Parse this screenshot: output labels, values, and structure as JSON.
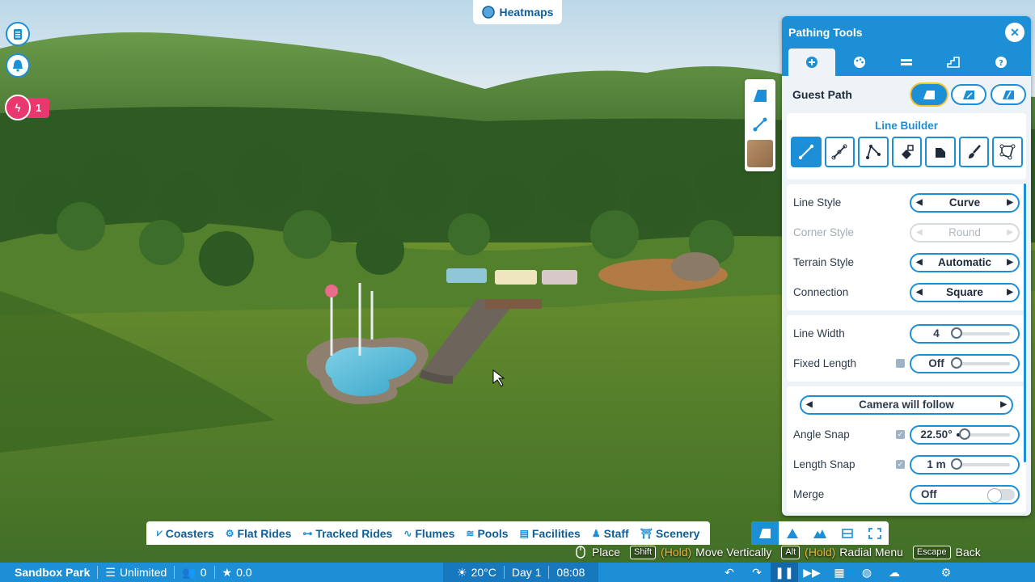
{
  "topbar": {
    "heatmaps_label": "Heatmaps"
  },
  "left_hud": {
    "notification_count": "1"
  },
  "panel": {
    "title": "Pathing Tools",
    "guest_path_label": "Guest Path",
    "line_builder_title": "Line Builder",
    "options": [
      {
        "label": "Line Style",
        "value": "Curve"
      },
      {
        "label": "Corner Style",
        "value": "Round"
      },
      {
        "label": "Terrain Style",
        "value": "Automatic"
      },
      {
        "label": "Connection",
        "value": "Square"
      }
    ],
    "line_width": {
      "label": "Line Width",
      "value": "4",
      "level": 0.0
    },
    "fixed_length": {
      "label": "Fixed Length",
      "value": "Off",
      "level": 0.0
    },
    "camera": {
      "value": "Camera will follow"
    },
    "angle_snap": {
      "label": "Angle Snap",
      "value": "22.50°",
      "level": 0.15
    },
    "length_snap": {
      "label": "Length Snap",
      "value": "1 m",
      "level": 0.0
    },
    "merge": {
      "label": "Merge",
      "value": "Off"
    }
  },
  "categories": [
    {
      "label": "Coasters",
      "icon": "coaster-icon"
    },
    {
      "label": "Flat Rides",
      "icon": "flat-ride-icon"
    },
    {
      "label": "Tracked Rides",
      "icon": "tracked-ride-icon"
    },
    {
      "label": "Flumes",
      "icon": "flume-icon"
    },
    {
      "label": "Pools",
      "icon": "pool-icon"
    },
    {
      "label": "Facilities",
      "icon": "facilities-icon"
    },
    {
      "label": "Staff",
      "icon": "staff-icon"
    },
    {
      "label": "Scenery",
      "icon": "scenery-icon"
    }
  ],
  "hints": {
    "place": "Place",
    "shift_key": "Shift",
    "hold1": "(Hold)",
    "move_vertically": "Move Vertically",
    "alt_key": "Alt",
    "hold2": "(Hold)",
    "radial_menu": "Radial Menu",
    "escape_key": "Escape",
    "back": "Back"
  },
  "status": {
    "park_name": "Sandbox Park",
    "money": "Unlimited",
    "guests": "0",
    "rating": "0.0",
    "temperature": "20°C",
    "day": "Day 1",
    "time": "08:08"
  },
  "colors": {
    "accent": "#1d8fd6",
    "notification": "#e9386d",
    "hold_text": "#f0b53a"
  }
}
